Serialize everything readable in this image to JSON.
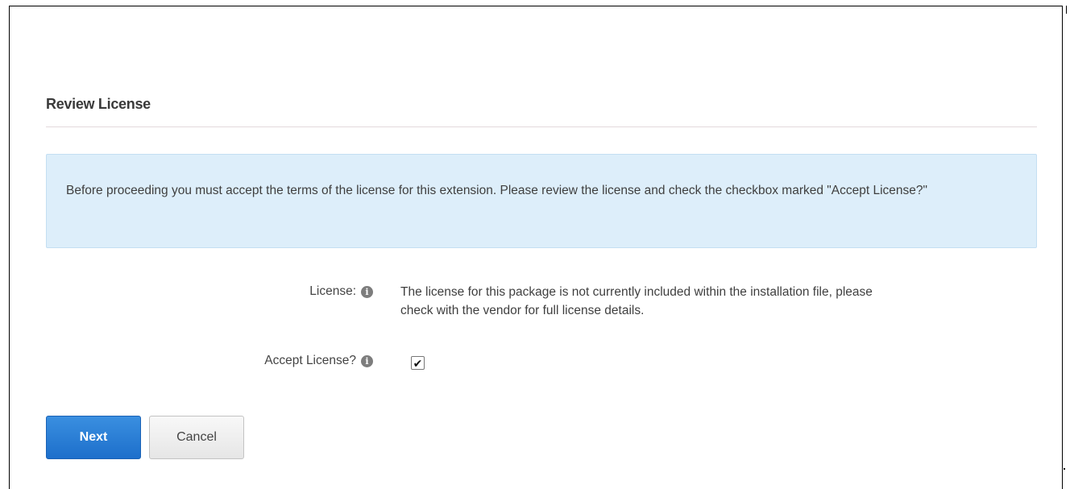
{
  "page": {
    "title": "Review License"
  },
  "notice": {
    "text": "Before proceeding you must accept the terms of the license for this extension. Please review the license and check the checkbox marked \"Accept License?\""
  },
  "fields": {
    "license": {
      "label": "License:",
      "value": "The license for this package is not currently included within the installation file, please check with the vendor for full license details."
    },
    "accept_license": {
      "label": "Accept License?",
      "checked": true,
      "check_glyph": "✔"
    }
  },
  "icons": {
    "info_glyph": "i"
  },
  "buttons": {
    "next": "Next",
    "cancel": "Cancel"
  },
  "colors": {
    "primary_button": "#1d6fcb",
    "info_background": "#ddeefa",
    "info_border": "#c4dff2"
  }
}
